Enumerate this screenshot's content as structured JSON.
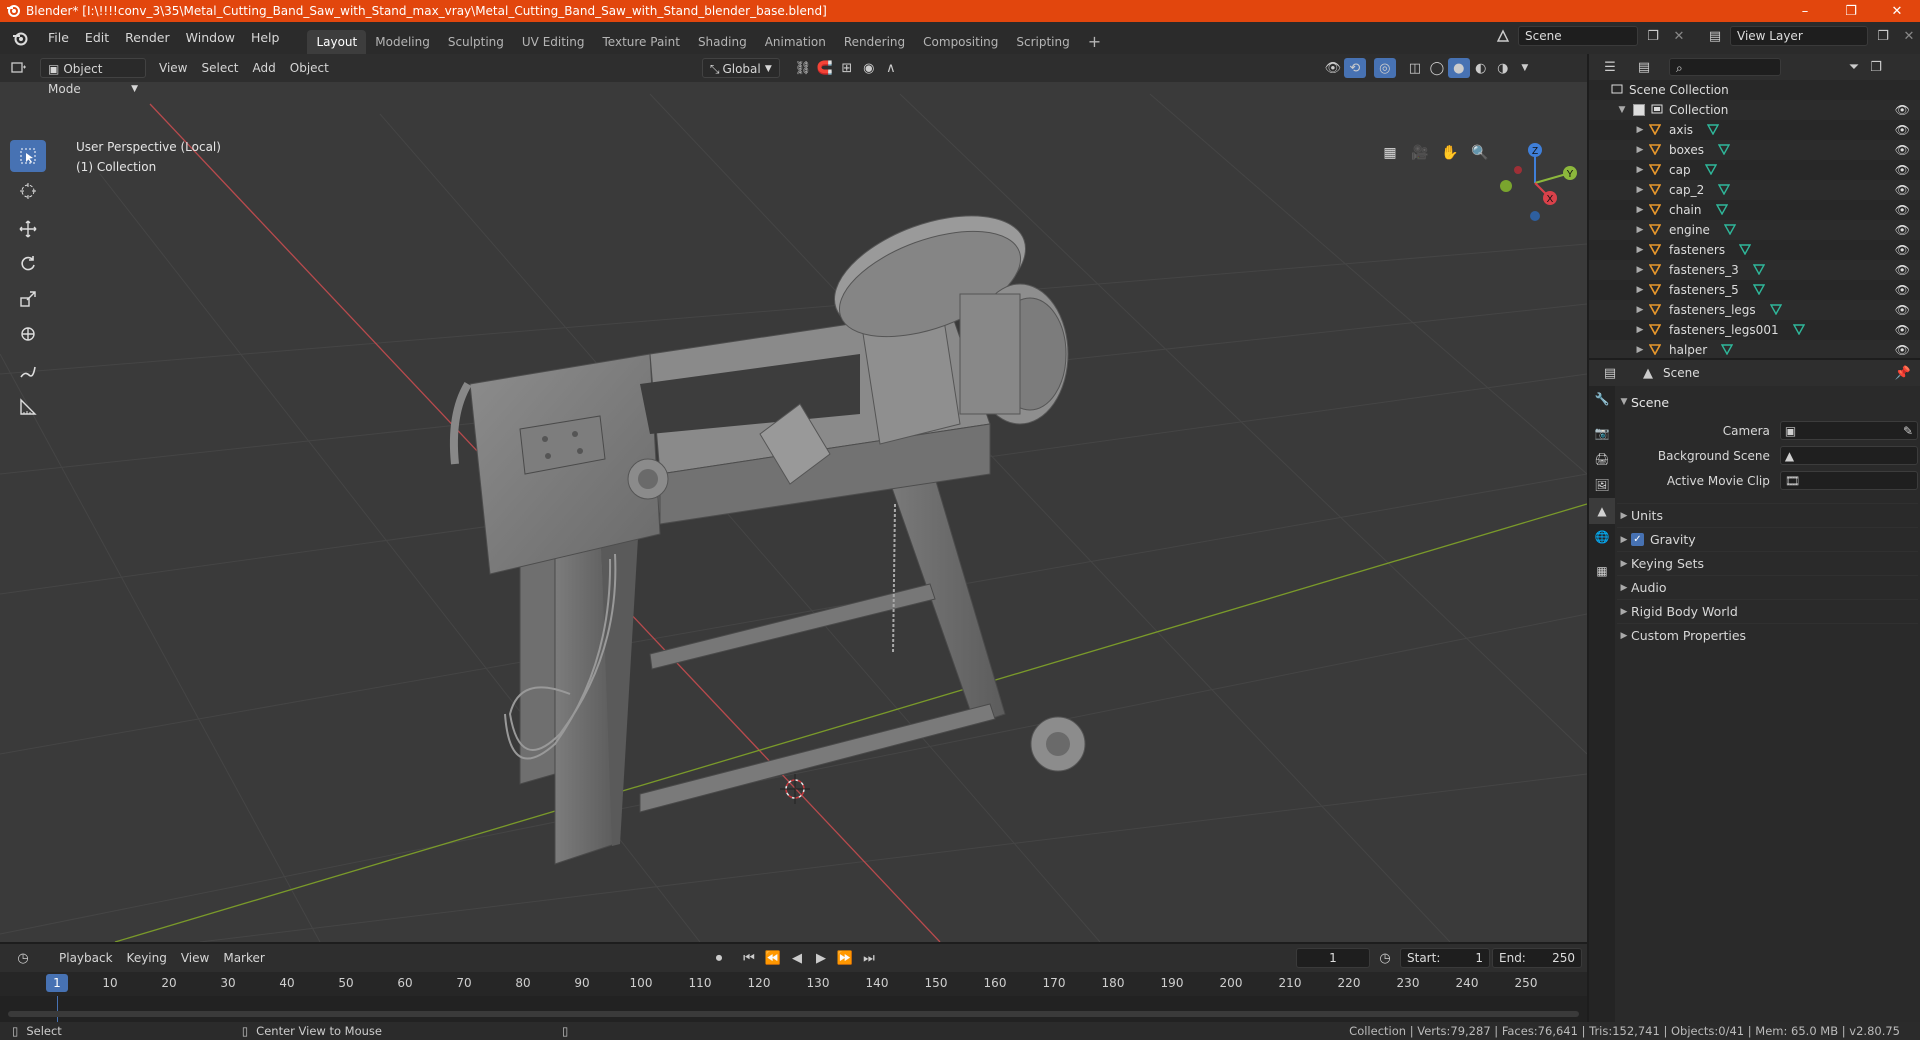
{
  "window": {
    "title": "Blender* [I:\\!!!!conv_3\\35\\Metal_Cutting_Band_Saw_with_Stand_max_vray\\Metal_Cutting_Band_Saw_with_Stand_blender_base.blend]",
    "minimize": "–",
    "maximize": "❐",
    "close": "✕"
  },
  "menu": {
    "items": [
      "File",
      "Edit",
      "Render",
      "Window",
      "Help"
    ]
  },
  "workspaces": {
    "tabs": [
      "Layout",
      "Modeling",
      "Sculpting",
      "UV Editing",
      "Texture Paint",
      "Shading",
      "Animation",
      "Rendering",
      "Compositing",
      "Scripting"
    ],
    "active": "Layout",
    "add": "+"
  },
  "scene_selector": {
    "value": "Scene"
  },
  "view_layer": {
    "value": "View Layer"
  },
  "viewport": {
    "mode": "Object Mode",
    "menus": [
      "View",
      "Select",
      "Add",
      "Object"
    ],
    "transform": "Global",
    "perspective": "User Perspective (Local)",
    "collection": "(1) Collection"
  },
  "gizmo": {
    "x": "X",
    "y": "Y",
    "z": "Z"
  },
  "outliner": {
    "search_placeholder": "",
    "root": "Scene Collection",
    "collection": "Collection",
    "objects": [
      "axis",
      "boxes",
      "cap",
      "cap_2",
      "chain",
      "engine",
      "fasteners",
      "fasteners_3",
      "fasteners_5",
      "fasteners_legs",
      "fasteners_legs001",
      "halper"
    ]
  },
  "properties": {
    "header": "Scene",
    "section": "Scene",
    "rows": [
      {
        "label": "Camera"
      },
      {
        "label": "Background Scene"
      },
      {
        "label": "Active Movie Clip"
      }
    ],
    "panels": [
      "Units",
      "Gravity",
      "Keying Sets",
      "Audio",
      "Rigid Body World",
      "Custom Properties"
    ],
    "gravity_checked": true
  },
  "timeline": {
    "menus": [
      "Playback",
      "Keying",
      "View",
      "Marker"
    ],
    "current_frame": "1",
    "start_label": "Start:",
    "start": "1",
    "end_label": "End:",
    "end": "250",
    "ticks": [
      "1",
      "10",
      "20",
      "30",
      "40",
      "50",
      "60",
      "70",
      "80",
      "90",
      "100",
      "110",
      "120",
      "130",
      "140",
      "150",
      "160",
      "170",
      "180",
      "190",
      "200",
      "210",
      "220",
      "230",
      "240",
      "250"
    ]
  },
  "statusbar": {
    "select": "Select",
    "center_view": "Center View to Mouse",
    "stats": "Collection | Verts:79,287 | Faces:76,641 | Tris:152,741 | Objects:0/41 | Mem: 65.0 MB | v2.80.75"
  },
  "colors": {
    "titlebar": "#e2460d",
    "accent": "#4772b3",
    "x_axis": "#d9414a",
    "y_axis": "#8cb73c",
    "z_axis": "#3f7fd9",
    "mesh_icon": "#2fb89b",
    "object_icon": "#e8982c"
  }
}
